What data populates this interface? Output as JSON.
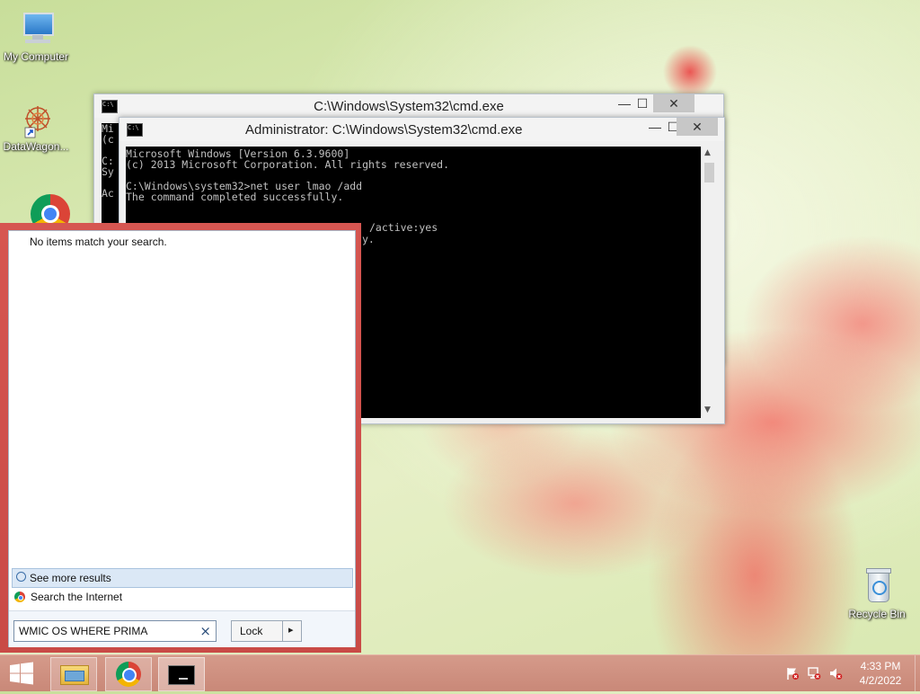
{
  "desktop": {
    "icons": [
      {
        "label": "My Computer"
      },
      {
        "label": "DataWagon..."
      },
      {
        "label": "Recycle Bin"
      }
    ]
  },
  "cmd_back": {
    "title": "C:\\Windows\\System32\\cmd.exe",
    "visible_left_text": "Mi\n(c\n\nC:\nSy\n\nAc"
  },
  "cmd_front": {
    "title": "Administrator: C:\\Windows\\System32\\cmd.exe",
    "console_text": "Microsoft Windows [Version 6.3.9600]\n(c) 2013 Microsoft Corporation. All rights reserved.\n\nC:\\Windows\\system32>net user lmao /add\nThe command completed successfully.",
    "partial_line_1": "/active:yes",
    "partial_line_2": "y."
  },
  "window_controls": {
    "minimize": "—",
    "maximize": "☐",
    "close": "✕"
  },
  "search": {
    "no_results": "No items match your search.",
    "see_more": "See more results",
    "search_internet": "Search the Internet",
    "query": "WMIC OS WHERE PRIMA",
    "clear_glyph": "×",
    "power_label": "Lock",
    "power_arrow": "▸"
  },
  "taskbar": {
    "time": "4:33 PM",
    "date": "4/2/2022"
  },
  "colors": {
    "search_frame": "#d65651",
    "console_bg": "#000000",
    "console_fg": "#c0c0c0",
    "taskbar": "#cf917f"
  }
}
